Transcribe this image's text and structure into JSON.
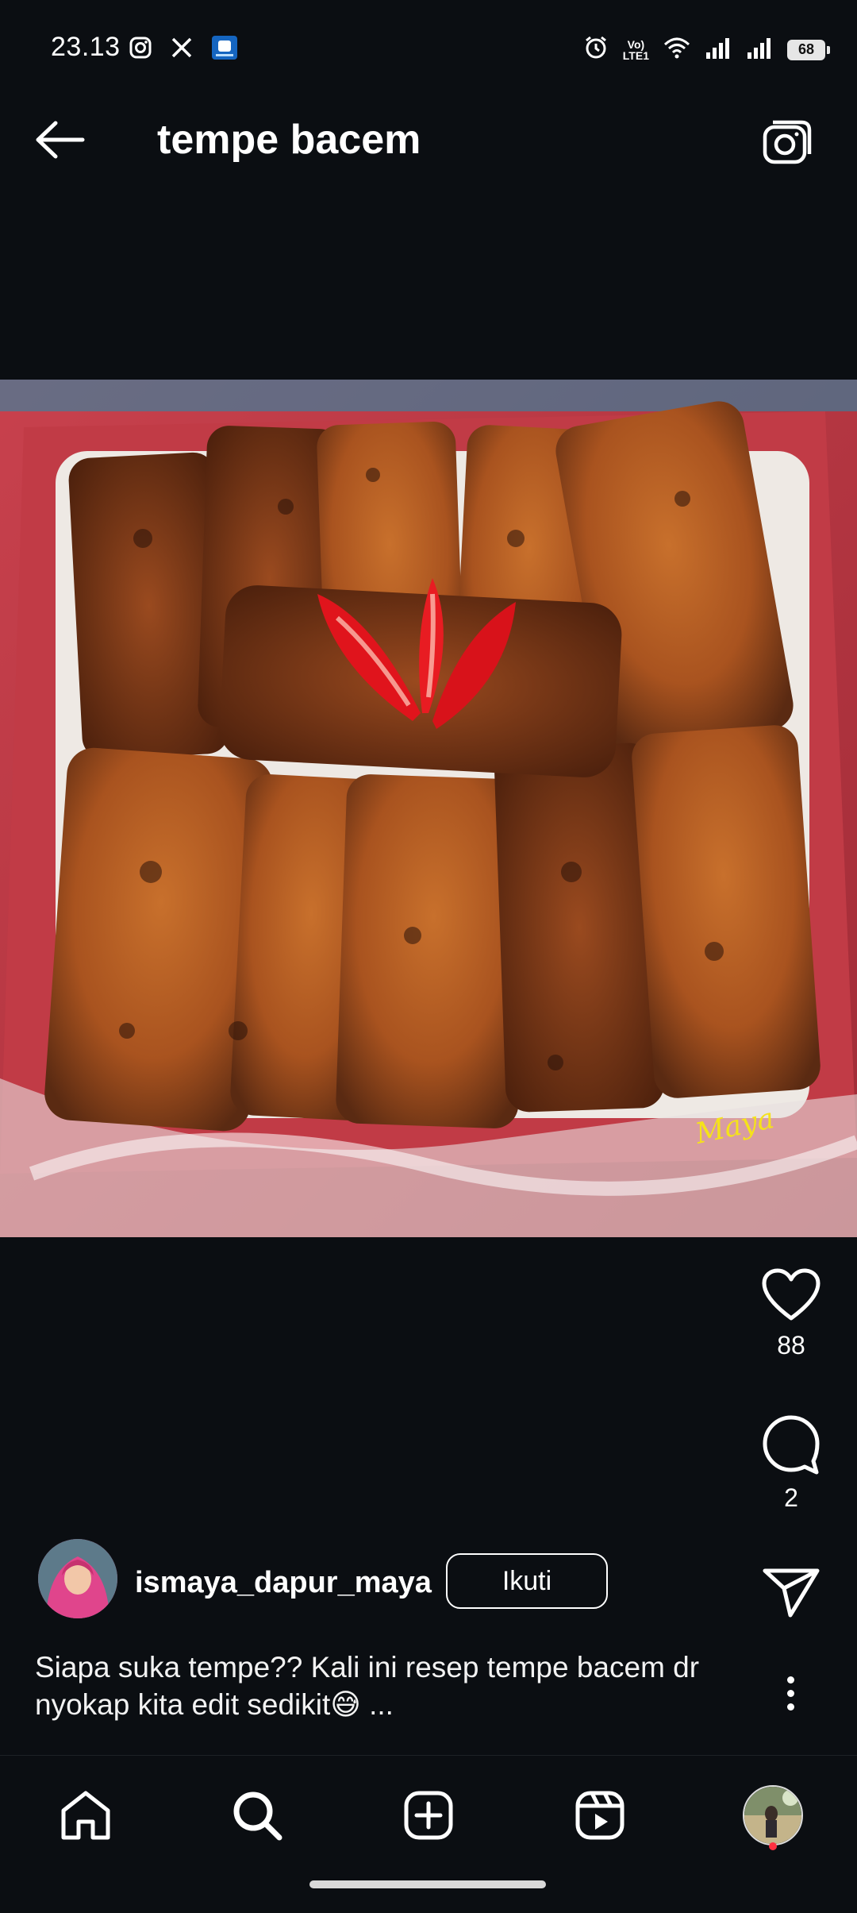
{
  "status_bar": {
    "time": "23.13",
    "battery": "68",
    "lte_top": "Vo)",
    "lte_bottom": "LTE1"
  },
  "header": {
    "title": "tempe bacem"
  },
  "post": {
    "watermark": "Maya",
    "likes": "88",
    "comments": "2",
    "author": {
      "username": "ismaya_dapur_maya",
      "follow_label": "Ikuti"
    },
    "caption_line1": "Siapa suka tempe?? Kali ini resep tempe bacem dr",
    "caption_line2": "nyokap kita edit sedikit😅 ..."
  },
  "colors": {
    "background": "#0b0e12",
    "text": "#ffffff",
    "notification_dot": "#ff3040",
    "plate_red": "#b3343e"
  },
  "icons": [
    "instagram-icon",
    "x-icon",
    "app-icon",
    "alarm-icon",
    "wifi-icon",
    "signal-icon",
    "back-arrow-icon",
    "camera-icon",
    "heart-icon",
    "comment-icon",
    "share-icon",
    "more-icon",
    "home-icon",
    "search-icon",
    "create-icon",
    "reels-icon",
    "profile-avatar"
  ]
}
